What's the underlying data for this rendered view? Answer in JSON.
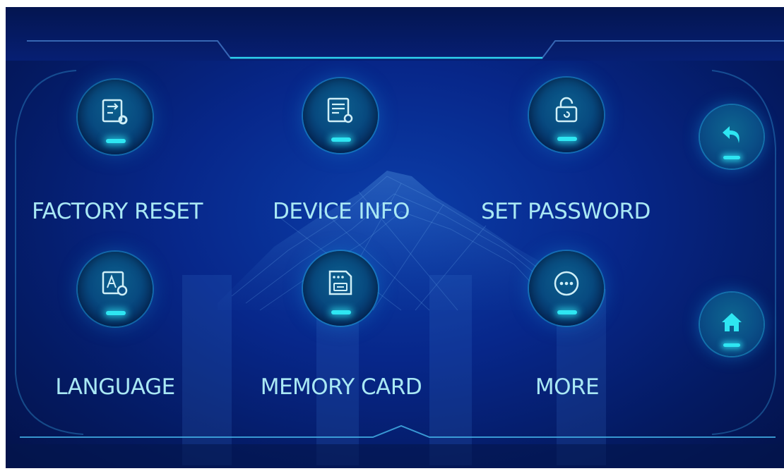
{
  "colors": {
    "background": "#07278a",
    "accent": "#2ee6f2",
    "label": "#a9e8f4"
  },
  "menu": {
    "items": [
      {
        "label": "FACTORY RESET",
        "icon": "factory-reset-icon"
      },
      {
        "label": "DEVICE INFO",
        "icon": "device-info-icon"
      },
      {
        "label": "SET PASSWORD",
        "icon": "lock-icon"
      },
      {
        "label": "LANGUAGE",
        "icon": "language-settings-icon"
      },
      {
        "label": "MEMORY CARD",
        "icon": "memory-card-icon"
      },
      {
        "label": "MORE",
        "icon": "more-icon"
      }
    ]
  },
  "side": {
    "back_icon": "back-arrow-icon",
    "home_icon": "home-icon"
  }
}
